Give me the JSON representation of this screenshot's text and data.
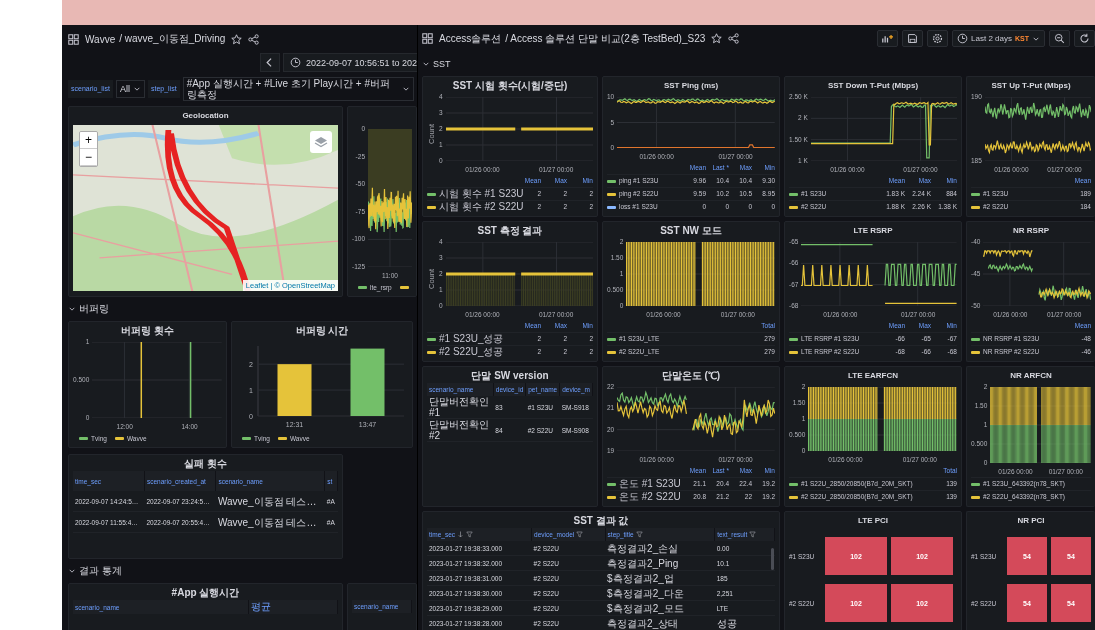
{
  "left_dashboard": {
    "breadcrumb": "Wavve",
    "title": "/ wavve_이동점_Driving",
    "time_range": "2022-09-07 10:56:51 to 202",
    "variables": [
      {
        "label": "scenario_list",
        "value": "All"
      },
      {
        "label": "step_list",
        "value": "#App 실행시간 + #Live 초기 Play시간 + #버퍼링측정"
      }
    ],
    "rows": [
      {
        "kind": "panels",
        "panels": [
          {
            "kind": "map",
            "title": "Geolocation",
            "zoom_in": "+",
            "zoom_out": "−",
            "attribution": "Leaflet | © OpenStreetMap"
          },
          {
            "kind": "graph",
            "yticks": [
              "0",
              "-25",
              "-50",
              "-75",
              "-100",
              "-125"
            ],
            "xticks": [
              "11:00"
            ],
            "legend": {
              "rows": [
                {
                  "name": "lte_rsrp",
                  "color": "#73bf69"
                },
                {
                  "color": "#e5c33a"
                }
              ]
            }
          }
        ]
      },
      {
        "kind": "section",
        "title": "버퍼링",
        "expanded": true
      },
      {
        "kind": "panels",
        "panels": [
          {
            "kind": "graph",
            "title": "버퍼링 횟수",
            "yticks": [
              "1",
              "0.500",
              "0"
            ],
            "xticks": [
              "12:00",
              "14:00"
            ],
            "legend": {
              "rows": [
                {
                  "name": "Tving",
                  "color": "#73bf69"
                },
                {
                  "name": "Wavve",
                  "color": "#e5c33a"
                }
              ]
            }
          },
          {
            "kind": "barchart",
            "chart_data": {
              "type": "bar",
              "title": "버퍼링 시간",
              "categories": [
                "12:31",
                "13:47"
              ],
              "series": [
                {
                  "name": "Tving",
                  "color": "#73bf69",
                  "values": [
                    null,
                    2.6
                  ]
                },
                {
                  "name": "Wavve",
                  "color": "#e5c33a",
                  "values": [
                    2,
                    null
                  ]
                }
              ],
              "ylim": [
                0,
                2.7
              ],
              "yticks": [
                0,
                1,
                2
              ]
            }
          }
        ]
      },
      {
        "kind": "panels",
        "panels": [
          {
            "kind": "table",
            "title": "실패 횟수",
            "columns": [
              {
                "label": "time_sec"
              },
              {
                "label": "scenario_created_at"
              },
              {
                "label": "scenario_name"
              },
              {
                "label": "st"
              }
            ],
            "rows": [
              [
                "2022-09-07 14:24:5…",
                "2022-09-07 23:24:5…",
                "Wavve_이동점 테스…",
                "#A"
              ],
              [
                "2022-09-07 11:55:4…",
                "2022-09-07 20:55:4…",
                "Wavve_이동점 테스…",
                "#A"
              ]
            ]
          }
        ]
      },
      {
        "kind": "section",
        "title": "결과 통계",
        "expanded": true
      },
      {
        "kind": "panels",
        "panels": [
          {
            "kind": "table",
            "title": "#App 실행시간",
            "columns": [
              {
                "label": "scenario_name"
              },
              {
                "label": "평균"
              }
            ]
          },
          {
            "kind": "table",
            "columns": [
              {
                "label": "scenario_name"
              }
            ]
          }
        ]
      }
    ]
  },
  "right_dashboard": {
    "breadcrumb": "Access솔루션",
    "title": "/ Access 솔루션 단말 비교(2층 TestBed)_S23",
    "time_range": "Last 2 days",
    "timezone": "KST",
    "section": {
      "title": "SST",
      "expanded": true
    },
    "panels": [
      {
        "kind": "graph",
        "title": "SST 시험 횟수(시험/중단)",
        "ylabel": "Count",
        "yticks": [
          "4",
          "3",
          "2",
          "1",
          "0"
        ],
        "xticks": [
          "01/26 00:00",
          "01/27 00:00"
        ],
        "legend": {
          "columns": [
            "Mean",
            "Max",
            "Min"
          ],
          "rows": [
            {
              "name": "시험 횟수 #1 S23U",
              "color": "#73bf69",
              "values": [
                "2",
                "2",
                "2"
              ]
            },
            {
              "name": "시험 횟수 #2 S22U",
              "color": "#e5c33a",
              "values": [
                "2",
                "2",
                "2"
              ]
            }
          ]
        }
      },
      {
        "kind": "graph",
        "title": "SST Ping (ms)",
        "yticks": [
          "10",
          "5",
          "0"
        ],
        "xticks": [
          "01/26 00:00",
          "01/27 00:00"
        ],
        "legend": {
          "columns": [
            "Mean",
            "Last *",
            "Max",
            "Min"
          ],
          "rows": [
            {
              "name": "ping #1 S23U",
              "color": "#73bf69",
              "values": [
                "9.96",
                "10.4",
                "10.4",
                "9.30"
              ]
            },
            {
              "name": "ping #2 S22U",
              "color": "#e5c33a",
              "values": [
                "9.59",
                "10.2",
                "10.5",
                "8.95"
              ]
            },
            {
              "name": "loss #1 S23U",
              "color": "#8ab8ff",
              "values": [
                "0",
                "0",
                "0",
                "0"
              ]
            }
          ]
        }
      },
      {
        "kind": "graph",
        "title": "SST Down T-Put (Mbps)",
        "yticks": [
          "2.50 K",
          "2 K",
          "1.50 K",
          "1 K"
        ],
        "xticks": [
          "01/26 00:00",
          "01/27 00:00"
        ],
        "legend": {
          "columns": [
            "Mean",
            "Max",
            "Min"
          ],
          "rows": [
            {
              "name": "#1 S23U",
              "color": "#73bf69",
              "values": [
                "1.83 K",
                "2.24 K",
                "884"
              ]
            },
            {
              "name": "#2 S22U",
              "color": "#e5c33a",
              "values": [
                "1.88 K",
                "2.26 K",
                "1.38 K"
              ]
            }
          ]
        }
      },
      {
        "kind": "graph",
        "title": "SST Up T-Put (Mbps)",
        "yticks": [
          "190",
          "185"
        ],
        "xticks": [
          "01/26 00:00",
          "01/27 00:00"
        ],
        "legend": {
          "columns": [
            "Mean"
          ],
          "rows": [
            {
              "name": "#1 S23U",
              "color": "#73bf69",
              "values": [
                "189"
              ]
            },
            {
              "name": "#2 S22U",
              "color": "#e5c33a",
              "values": [
                "184"
              ]
            }
          ]
        }
      },
      {
        "kind": "graph",
        "title": "SST 측정 결과",
        "ylabel": "Count",
        "yticks": [
          "4",
          "3",
          "2",
          "1",
          "0"
        ],
        "xticks": [
          "01/26 00:00",
          "01/27 00:00"
        ],
        "legend": {
          "columns": [
            "Mean",
            "Max",
            "Min"
          ],
          "rows": [
            {
              "name": "#1 S23U_성공",
              "color": "#73bf69",
              "values": [
                "2",
                "2",
                "2"
              ]
            },
            {
              "name": "#2 S22U_성공",
              "color": "#e5c33a",
              "values": [
                "2",
                "2",
                "2"
              ]
            }
          ]
        }
      },
      {
        "kind": "graph",
        "title": "SST NW 모드",
        "yticks": [
          "2",
          "1.50",
          "1",
          "0.500",
          "0"
        ],
        "xticks": [
          "01/26 00:00",
          "01/27 00:00"
        ],
        "legend": {
          "columns": [
            "Total"
          ],
          "rows": [
            {
              "name": "#1 S23U_LTE",
              "color": "#73bf69",
              "values": [
                "279"
              ]
            },
            {
              "name": "#2 S22U_LTE",
              "color": "#e5c33a",
              "values": [
                "279"
              ]
            }
          ]
        }
      },
      {
        "kind": "graph",
        "title": "LTE RSRP",
        "yticks": [
          "-65",
          "-66",
          "-67",
          "-68"
        ],
        "xticks": [
          "01/26 00:00",
          "01/27 00:00"
        ],
        "legend": {
          "columns": [
            "Mean",
            "Max",
            "Min"
          ],
          "rows": [
            {
              "name": "LTE RSRP #1 S23U",
              "color": "#73bf69",
              "values": [
                "-66",
                "-65",
                "-67"
              ]
            },
            {
              "name": "LTE RSRP #2 S22U",
              "color": "#e5c33a",
              "values": [
                "-68",
                "-66",
                "-68"
              ]
            }
          ]
        }
      },
      {
        "kind": "graph",
        "title": "NR RSRP",
        "yticks": [
          "-40",
          "-45",
          "-50"
        ],
        "xticks": [
          "01/26 00:00",
          "01/27 00:00"
        ],
        "legend": {
          "columns": [
            "Mean"
          ],
          "rows": [
            {
              "name": "NR RSRP #1 S23U",
              "color": "#73bf69",
              "values": [
                "-48"
              ]
            },
            {
              "name": "NR RSRP #2 S22U",
              "color": "#e5c33a",
              "values": [
                "-46"
              ]
            }
          ]
        }
      },
      {
        "kind": "table",
        "title": "단말 SW version",
        "columns": [
          {
            "label": "scenario_name"
          },
          {
            "label": "device_id"
          },
          {
            "label": "pet_name"
          },
          {
            "label": "device_m"
          }
        ],
        "rows": [
          [
            "단말버전확인 #1",
            "83",
            "#1 S23U",
            "SM-S918"
          ],
          [
            "단말버전확인 #2",
            "84",
            "#2 S22U",
            "SM-S908"
          ]
        ]
      },
      {
        "kind": "graph",
        "title": "단말온도 (℃)",
        "yticks": [
          "22",
          "21",
          "20",
          "19"
        ],
        "xticks": [
          "01/26 00:00",
          "01/27 00:00"
        ],
        "legend": {
          "columns": [
            "Mean",
            "Last *",
            "Max",
            "Min"
          ],
          "rows": [
            {
              "name": "온도 #1 S23U",
              "color": "#73bf69",
              "values": [
                "21.1",
                "20.4",
                "22.4",
                "19.2"
              ]
            },
            {
              "name": "온도 #2 S22U",
              "color": "#e5c33a",
              "values": [
                "20.8",
                "21.2",
                "22",
                "19.2"
              ]
            }
          ]
        }
      },
      {
        "kind": "graph",
        "title": "LTE EARFCN",
        "yticks": [
          "2",
          "1.50",
          "1",
          "0.500",
          "0"
        ],
        "xticks": [
          "01/26 00:00",
          "01/27 00:00"
        ],
        "legend": {
          "columns": [
            "Total"
          ],
          "rows": [
            {
              "name": "#1 S22U_2850/20850(B7d_20M_SKT)",
              "color": "#73bf69",
              "values": [
                "139"
              ]
            },
            {
              "name": "#2 S22U_2850/20850(B7d_20M_SKT)",
              "color": "#e5c33a",
              "values": [
                "139"
              ]
            }
          ]
        }
      },
      {
        "kind": "graph",
        "title": "NR ARFCN",
        "yticks": [
          "2",
          "1.50",
          "1",
          "0.500",
          "0"
        ],
        "xticks": [
          "01/26 00:00",
          "01/27 00:00"
        ],
        "legend": {
          "rows": [
            {
              "name": "#1 S23U_643392(n78_SKT)",
              "color": "#73bf69"
            },
            {
              "name": "#2 S22U_643392(n78_SKT)",
              "color": "#e5c33a"
            }
          ]
        }
      },
      {
        "kind": "table",
        "title": "SST 결과 값",
        "columns": [
          {
            "label": "time_sec",
            "sorted": true,
            "filter": true
          },
          {
            "label": "device_model",
            "filter": true
          },
          {
            "label": "step_title",
            "filter": true
          },
          {
            "label": "text_result",
            "filter": true
          }
        ],
        "rows": [
          [
            "2023-01-27 19:38:33.000",
            "#2 S22U",
            "측정결과2_손실",
            "0.00"
          ],
          [
            "2023-01-27 19:38:32.000",
            "#2 S22U",
            "측정결과2_Ping",
            "10.1"
          ],
          [
            "2023-01-27 19:38:31.000",
            "#2 S22U",
            "$측정결과2_업",
            "185"
          ],
          [
            "2023-01-27 19:38:30.000",
            "#2 S22U",
            "$측정결과2_다운",
            "2,251"
          ],
          [
            "2023-01-27 19:38:29.000",
            "#2 S22U",
            "$측정결과2_모드",
            "LTE"
          ],
          [
            "2023-01-27 19:38:28.000",
            "#2 S22U",
            "측정결과2_상태",
            "성공"
          ]
        ]
      },
      {
        "kind": "blocks",
        "title": "LTE PCI",
        "rows": [
          {
            "label": "#1 S23U",
            "cells": [
              "102",
              "102"
            ]
          },
          {
            "label": "#2 S22U",
            "cells": [
              "102",
              "102"
            ]
          }
        ]
      },
      {
        "kind": "blocks",
        "title": "NR PCI",
        "rows": [
          {
            "label": "#1 S23U",
            "cells": [
              "54",
              "54"
            ]
          },
          {
            "label": "#2 S22U",
            "cells": [
              "54",
              "54"
            ]
          }
        ]
      }
    ]
  }
}
